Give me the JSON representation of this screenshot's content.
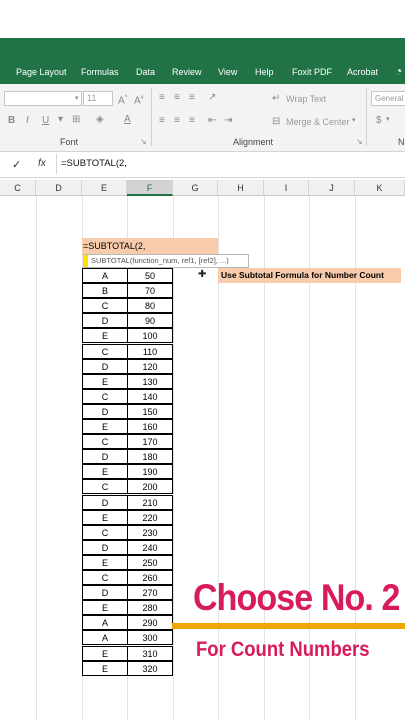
{
  "ribbon": {
    "tabs": [
      "Page Layout",
      "Formulas",
      "Data",
      "Review",
      "View",
      "Help",
      "Foxit PDF",
      "Acrobat"
    ],
    "font_size": "11",
    "wrap_text": "Wrap Text",
    "merge_center": "Merge & Center",
    "number_format": "General",
    "groups": {
      "font": "Font",
      "alignment": "Alignment"
    },
    "currency": "$"
  },
  "formula_bar": {
    "cancel": "✓",
    "fx": "fx",
    "formula": "=SUBTOTAL(2,"
  },
  "columns": [
    "C",
    "D",
    "E",
    "F",
    "G",
    "H",
    "I",
    "J",
    "K"
  ],
  "editing": {
    "formula": "=SUBTOTAL(2,",
    "tooltip": "SUBTOTAL(function_num, ref1, [ref2], ...)",
    "note": "Use Subtotal Formula for Number Count"
  },
  "table": {
    "rows": [
      [
        "A",
        "50"
      ],
      [
        "B",
        "70"
      ],
      [
        "C",
        "80"
      ],
      [
        "D",
        "90"
      ],
      [
        "E",
        "100"
      ],
      [
        "C",
        "110"
      ],
      [
        "D",
        "120"
      ],
      [
        "E",
        "130"
      ],
      [
        "C",
        "140"
      ],
      [
        "D",
        "150"
      ],
      [
        "E",
        "160"
      ],
      [
        "C",
        "170"
      ],
      [
        "D",
        "180"
      ],
      [
        "E",
        "190"
      ],
      [
        "C",
        "200"
      ],
      [
        "D",
        "210"
      ],
      [
        "E",
        "220"
      ],
      [
        "C",
        "230"
      ],
      [
        "D",
        "240"
      ],
      [
        "E",
        "250"
      ],
      [
        "C",
        "260"
      ],
      [
        "D",
        "270"
      ],
      [
        "E",
        "280"
      ],
      [
        "A",
        "290"
      ],
      [
        "A",
        "300"
      ],
      [
        "E",
        "310"
      ],
      [
        "E",
        "320"
      ]
    ]
  },
  "overlay": {
    "headline": "Choose No. 2",
    "subline": "For Count Numbers"
  },
  "colors": {
    "ribbon": "#217346",
    "highlight": "#f8cbad",
    "overlay_text": "#d81b5a",
    "accent_bar": "#f0a500"
  }
}
